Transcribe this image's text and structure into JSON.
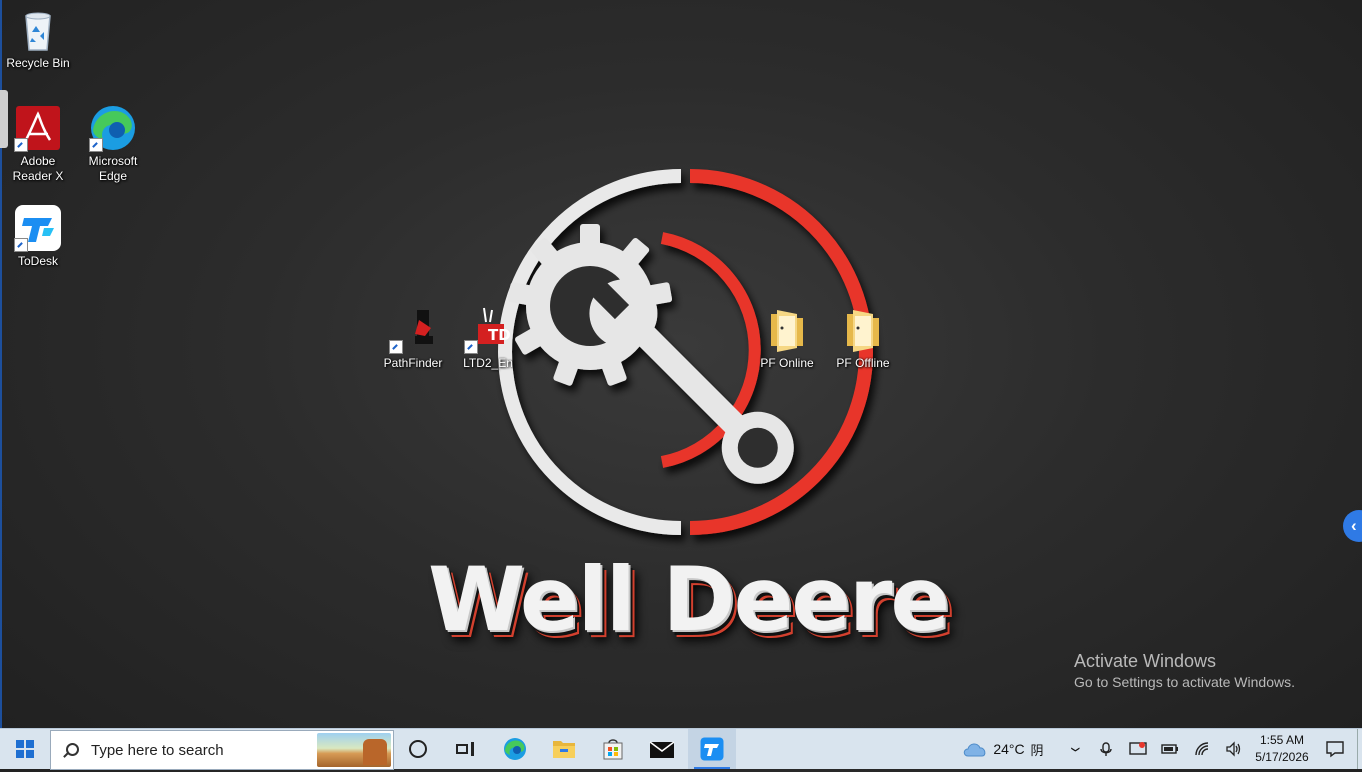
{
  "desktop": {
    "icons": [
      {
        "label": "Recycle Bin",
        "icon": "recycle-bin-icon"
      },
      {
        "label": "Adobe\nReader X",
        "icon": "adobe-reader-icon"
      },
      {
        "label": "Microsoft\nEdge",
        "icon": "edge-icon"
      },
      {
        "label": "ToDesk",
        "icon": "todesk-icon"
      },
      {
        "label": "PathFinder",
        "icon": "pathfinder-icon"
      },
      {
        "label": "LTD2_En",
        "icon": "ltd2-icon"
      },
      {
        "label": "PF Online",
        "icon": "folder-icon"
      },
      {
        "label": "PF Offline",
        "icon": "folder-icon"
      }
    ],
    "wallpaper": {
      "brand": "Well Deere",
      "accent": "#e8362c",
      "ring": "#e9e9e9"
    },
    "activation": {
      "title": "Activate Windows",
      "subtitle": "Go to Settings to activate Windows."
    }
  },
  "taskbar": {
    "search_placeholder": "Type here to search",
    "pinned": [
      "cortana-icon",
      "task-view-icon",
      "edge-icon",
      "file-explorer-icon",
      "store-icon",
      "mail-icon",
      "todesk-icon"
    ],
    "weather": {
      "temp": "24°C",
      "condition": "阴"
    },
    "clock": {
      "time": "1:55 AM",
      "date": "5/17/2026"
    }
  },
  "colors": {
    "taskbar_bg": "#d9e4ee",
    "accent": "#2f7ae5"
  }
}
